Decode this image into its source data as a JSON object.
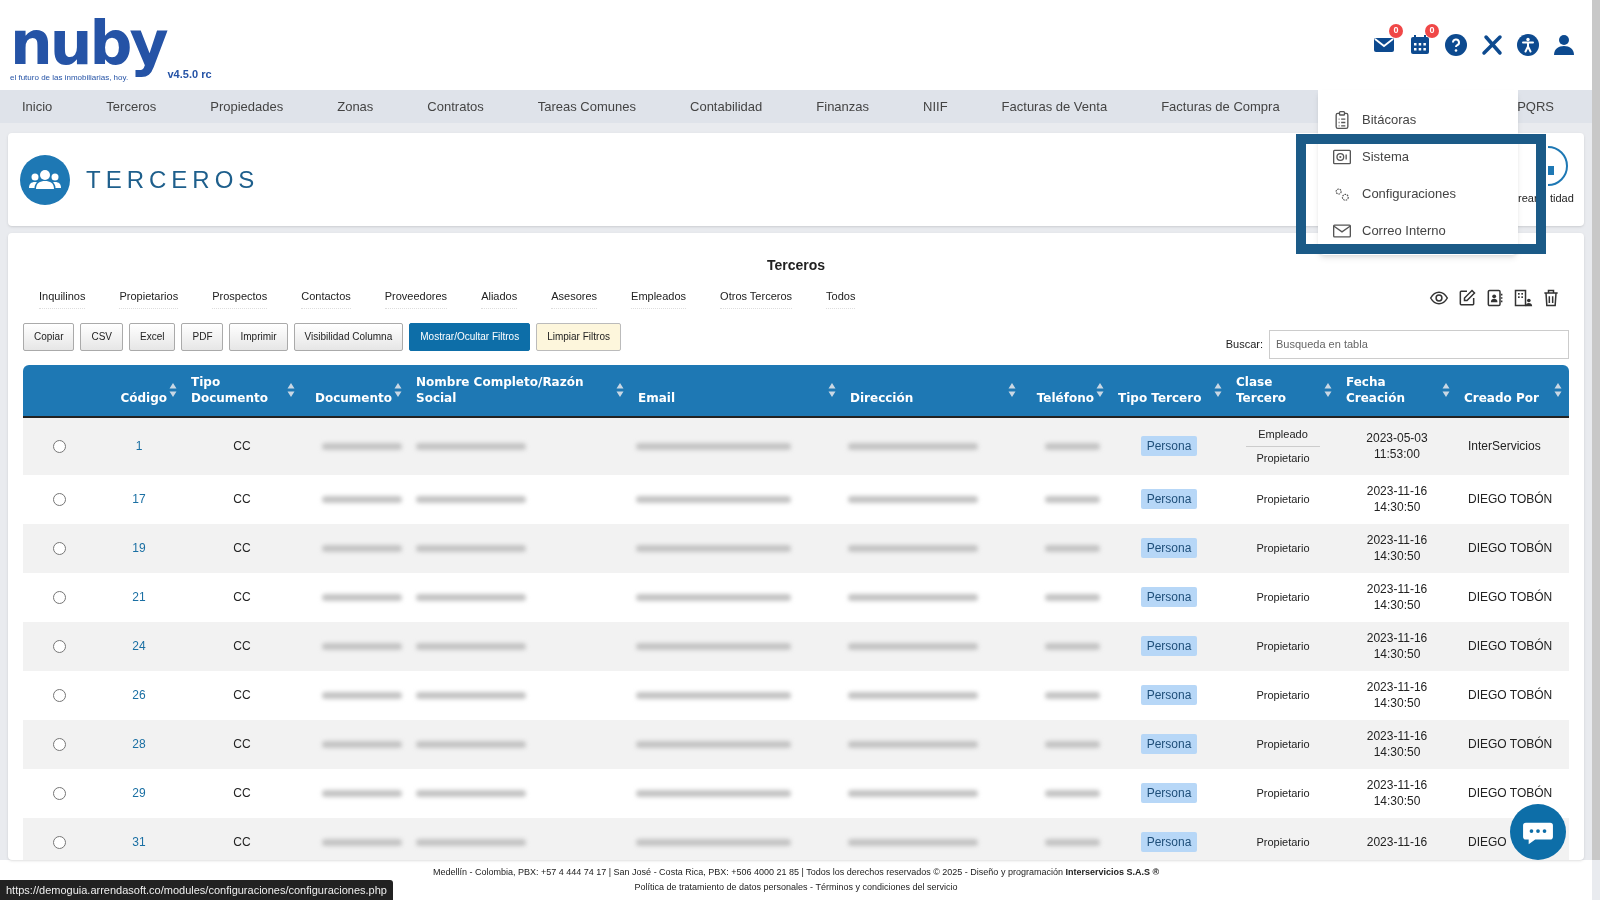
{
  "header": {
    "brand": "nuby",
    "tagline": "el futuro de las inmobiliarias, hoy.",
    "version": "v4.5.0 rc",
    "icons": [
      {
        "kind": "mail",
        "badge": "0"
      },
      {
        "kind": "calendar",
        "badge": "0"
      },
      {
        "kind": "help"
      },
      {
        "kind": "tools"
      },
      {
        "kind": "accessibility"
      },
      {
        "kind": "user"
      }
    ]
  },
  "nav": {
    "items": [
      "Inicio",
      "Terceros",
      "Propiedades",
      "Zonas",
      "Contratos",
      "Tareas Comunes",
      "Contabilidad",
      "Finanzas",
      "NIIF",
      "Facturas de Venta",
      "Facturas de Compra"
    ],
    "trailing": "PQRS"
  },
  "dropdown": {
    "items": [
      {
        "kind": "clipboard",
        "label": "Bitácoras"
      },
      {
        "kind": "safe",
        "label": "Sistema"
      },
      {
        "kind": "gears",
        "label": "Configuraciones"
      },
      {
        "kind": "envelope",
        "label": "Correo Interno"
      }
    ]
  },
  "page_title": {
    "title": "TERCEROS",
    "crear_entidad_fragments": [
      "rear",
      "tidad"
    ]
  },
  "table_card": {
    "title": "Terceros",
    "filter_tabs": [
      "Inquilinos",
      "Propietarios",
      "Prospectos",
      "Contactos",
      "Proveedores",
      "Aliados",
      "Asesores",
      "Empleados",
      "Otros Terceros",
      "Todos"
    ],
    "export_buttons": [
      {
        "label": "Copiar",
        "kind": "default"
      },
      {
        "label": "CSV",
        "kind": "default"
      },
      {
        "label": "Excel",
        "kind": "default"
      },
      {
        "label": "PDF",
        "kind": "default"
      },
      {
        "label": "Imprimir",
        "kind": "default"
      },
      {
        "label": "Visibilidad Columna",
        "kind": "default"
      },
      {
        "label": "Mostrar/Ocultar Filtros",
        "kind": "primary"
      },
      {
        "label": "Limpiar Filtros",
        "kind": "warning"
      }
    ],
    "search": {
      "label": "Buscar:",
      "placeholder": "Busqueda en tabla"
    },
    "columns": [
      "Código",
      "Tipo Documento",
      "Documento",
      "Nombre Completo/Razón Social",
      "Email",
      "Dirección",
      "Teléfono",
      "Tipo Tercero",
      "Clase Tercero",
      "Fecha Creación",
      "Creado Por"
    ],
    "rows": [
      {
        "selected": false,
        "codigo": "1",
        "tipo_documento": "CC",
        "tipo_tercero": "Persona",
        "clase_tercero": [
          "Empleado",
          "Propietario"
        ],
        "fecha": "2023-05-03",
        "hora": "11:53:00",
        "creado_por": "InterServicios"
      },
      {
        "selected": false,
        "codigo": "17",
        "tipo_documento": "CC",
        "tipo_tercero": "Persona",
        "clase_tercero": [
          "Propietario"
        ],
        "fecha": "2023-11-16",
        "hora": "14:30:50",
        "creado_por": "DIEGO TOBÓN"
      },
      {
        "selected": false,
        "codigo": "19",
        "tipo_documento": "CC",
        "tipo_tercero": "Persona",
        "clase_tercero": [
          "Propietario"
        ],
        "fecha": "2023-11-16",
        "hora": "14:30:50",
        "creado_por": "DIEGO TOBÓN"
      },
      {
        "selected": false,
        "codigo": "21",
        "tipo_documento": "CC",
        "tipo_tercero": "Persona",
        "clase_tercero": [
          "Propietario"
        ],
        "fecha": "2023-11-16",
        "hora": "14:30:50",
        "creado_por": "DIEGO TOBÓN"
      },
      {
        "selected": false,
        "codigo": "24",
        "tipo_documento": "CC",
        "tipo_tercero": "Persona",
        "clase_tercero": [
          "Propietario"
        ],
        "fecha": "2023-11-16",
        "hora": "14:30:50",
        "creado_por": "DIEGO TOBÓN"
      },
      {
        "selected": false,
        "codigo": "26",
        "tipo_documento": "CC",
        "tipo_tercero": "Persona",
        "clase_tercero": [
          "Propietario"
        ],
        "fecha": "2023-11-16",
        "hora": "14:30:50",
        "creado_por": "DIEGO TOBÓN"
      },
      {
        "selected": false,
        "codigo": "28",
        "tipo_documento": "CC",
        "tipo_tercero": "Persona",
        "clase_tercero": [
          "Propietario"
        ],
        "fecha": "2023-11-16",
        "hora": "14:30:50",
        "creado_por": "DIEGO TOBÓN"
      },
      {
        "selected": false,
        "codigo": "29",
        "tipo_documento": "CC",
        "tipo_tercero": "Persona",
        "clase_tercero": [
          "Propietario"
        ],
        "fecha": "2023-11-16",
        "hora": "14:30:50",
        "creado_por": "DIEGO TOBÓN"
      },
      {
        "selected": false,
        "codigo": "31",
        "tipo_documento": "CC",
        "tipo_tercero": "Persona",
        "clase_tercero": [
          "Propietario"
        ],
        "fecha": "2023-11-16",
        "creado_por": "DIEGO"
      }
    ]
  },
  "footer": {
    "line_1": "Medellín - Colombia, PBX: +57 4 444 74 17 | San José - Costa Rica, PBX: +506 4000 21 85 | Todos los derechos reservados © 2025 - Diseño y programación **Interservicios S.A.S ®**",
    "line_2": "Política de tratamiento de datos personales - Términos y condiciones del servicio"
  },
  "status_url": "https://demoguia.arrendasoft.co/modules/configuraciones/configuraciones.php"
}
